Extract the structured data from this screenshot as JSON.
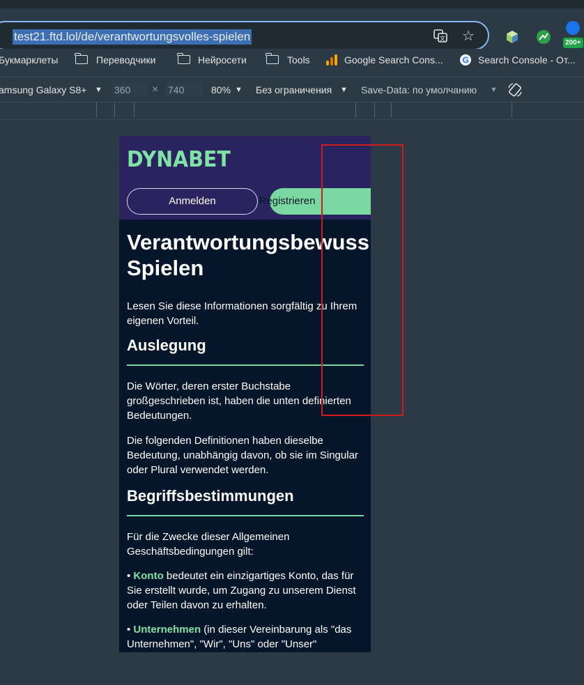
{
  "browser": {
    "url": "test21.ftd.lol/de/verantwortungsvolles-spielen",
    "extensions_badge": "200+",
    "icons": [
      "site-info-icon",
      "translate-icon",
      "star-icon",
      "extension-hexagon-icon",
      "extension-leaf-icon",
      "extension-badge-icon"
    ]
  },
  "bookmarks": [
    {
      "label": "Букмарклеты",
      "icon": "none"
    },
    {
      "label": "Переводчики",
      "icon": "folder-icon"
    },
    {
      "label": "Нейросети",
      "icon": "folder-icon"
    },
    {
      "label": "Tools",
      "icon": "folder-icon"
    },
    {
      "label": "Google Search Cons...",
      "icon": "analytics-icon"
    },
    {
      "label": "Search Console - От...",
      "icon": "google-icon"
    }
  ],
  "devtools": {
    "device": "amsung Galaxy S8+",
    "width": "360",
    "height": "740",
    "zoom": "80%",
    "throttling": "Без ограничения",
    "save_data": "Save-Data: по умолчанию"
  },
  "site": {
    "logo": "DYNABET",
    "login_label": "Anmelden",
    "register_label": "Registrieren",
    "title_line1": "Verantwortungsbewuss",
    "title_line2": "Spielen",
    "intro": "Lesen Sie diese Informationen sorgfältig zu Ihrem eigenen Vorteil.",
    "section1_heading": "Auslegung",
    "section1_p1": "Die Wörter, deren erster Buchstabe großgeschrieben ist, haben die unten definierten Bedeutungen.",
    "section1_p2": "Die folgenden Definitionen haben dieselbe Bedeutung, unabhängig davon, ob sie im Singular oder Plural verwendet werden.",
    "section2_heading": "Begriffsbestimmungen",
    "section2_intro": "Für die Zwecke dieser Allgemeinen Geschäftsbedingungen gilt:",
    "def1_prefix": "• ",
    "def1_term": "Konto",
    "def1_text": " bedeutet ein einzigartiges Konto, das für Sie erstellt wurde, um Zugang zu unserem Dienst oder Teilen davon zu erhalten.",
    "def2_prefix": "• ",
    "def2_term": "Unternehmen",
    "def2_text": " (in dieser Vereinbarung als \"das Unternehmen\", \"Wir\", \"Uns\" oder \"Unser\""
  },
  "colors": {
    "accent_green": "#7ad9a0",
    "header_purple": "#2a235f",
    "page_navy": "#05162a",
    "highlight_red": "#d11a1a"
  }
}
